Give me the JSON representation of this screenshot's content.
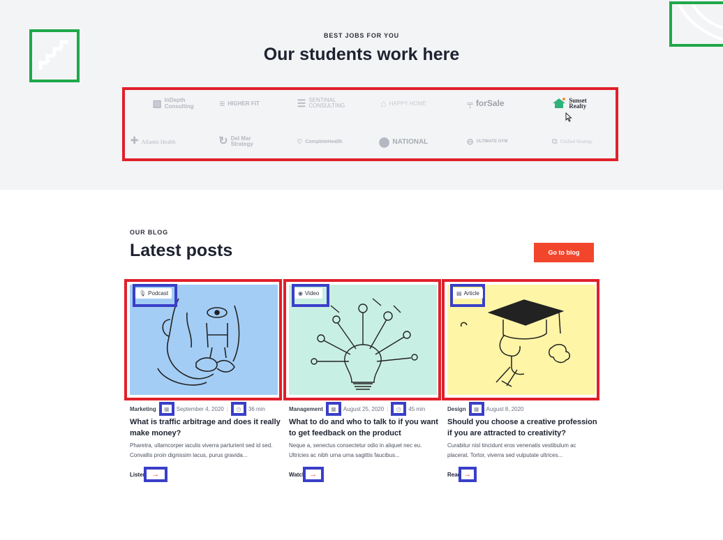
{
  "partners": {
    "kicker": "BEST JOBS FOR YOU",
    "title": "Our students work here",
    "logos": [
      {
        "name": "InDepth Consulting",
        "line1": "InDepth",
        "line2": "Consulting",
        "icon": "square-icon"
      },
      {
        "name": "Higher Fit",
        "text": "HIGHER FIT",
        "icon": "lines-icon"
      },
      {
        "name": "Sentinal Consulting",
        "line1": "SENTINAL",
        "line2": "CONSULTING",
        "icon": "stripes-icon"
      },
      {
        "name": "Happy Home",
        "text": "HAPPY HOME",
        "icon": "house-icon"
      },
      {
        "name": "forSale",
        "text": "forSale",
        "icon": "sign-icon"
      },
      {
        "name": "Sunset Realty",
        "line1": "Sunset",
        "line2": "Realty",
        "icon": "sunset-house-icon"
      },
      {
        "name": "Atlantis Health",
        "text": "Atlantis Health",
        "icon": "cross-icon"
      },
      {
        "name": "Del Mar Strategy",
        "line1": "Del Mar",
        "line2": "Strategy",
        "icon": "wave-icon"
      },
      {
        "name": "Complete Health",
        "text": "CompleteHealth",
        "icon": "heart-icon"
      },
      {
        "name": "National",
        "text": "NATIONAL",
        "icon": "shield-icon"
      },
      {
        "name": "Ultimate Gym",
        "text": "ULTIMATE GYM",
        "icon": "arrow-circle-icon"
      },
      {
        "name": "Unified Strategy",
        "text": "Unified Strategy",
        "icon": "overlap-squares-icon"
      }
    ]
  },
  "blog": {
    "kicker": "OUR BLOG",
    "title": "Latest posts",
    "cta": "Go to blog",
    "posts": [
      {
        "badge": "Podcast",
        "badge_icon": "microphone-icon",
        "category": "Marketing",
        "date": "September 4, 2020",
        "duration": "36 min",
        "title": "What is traffic arbitrage and does it really make money?",
        "excerpt": "Pharetra, ullamcorper iaculis viverra parturient sed id sed. Convallis proin dignissim lacus, purus gravida...",
        "action": "Listen",
        "bg": "#a3cdf5"
      },
      {
        "badge": "Video",
        "badge_icon": "play-icon",
        "category": "Management",
        "date": "August 25, 2020",
        "duration": "45 min",
        "title": "What to do and who to talk to if you want to get feedback on the product",
        "excerpt": "Neque a, senectus consectetur odio in aliquet nec eu. Ultricies ac nibh urna urna sagittis faucibus...",
        "action": "Watch",
        "bg": "#c8efe3"
      },
      {
        "badge": "Article",
        "badge_icon": "document-icon",
        "category": "Design",
        "date": "August 8, 2020",
        "duration": "",
        "title": "Should you choose a creative profession if you are attracted to creativity?",
        "excerpt": "Curabitur nisl tincidunt eros venenatis vestibulum ac placerat. Tortor, viverra sed vulputate ultrices...",
        "action": "Read",
        "bg": "#fff5a6"
      }
    ]
  },
  "colors": {
    "accent": "#f2462c",
    "annotation_red": "#e0202a",
    "annotation_blue": "#3a3fc8",
    "annotation_green": "#1fa84a"
  }
}
